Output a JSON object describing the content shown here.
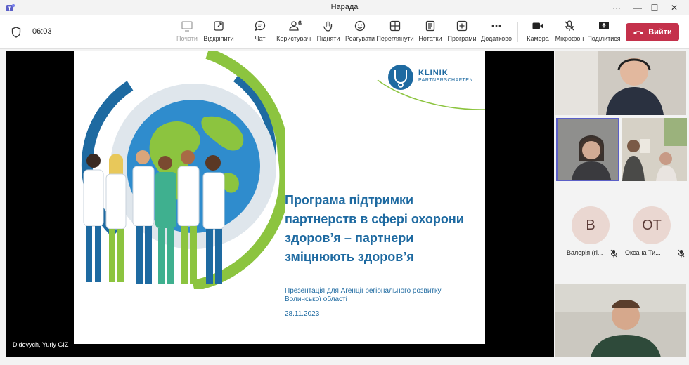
{
  "window": {
    "title": "Нарада"
  },
  "toolbar": {
    "timer": "06:03",
    "buttons": {
      "start": "Почати",
      "detach": "Відкріпити",
      "chat": "Чат",
      "people": "Користувачі",
      "people_count": "6",
      "raise": "Підняти",
      "react": "Реагувати",
      "view": "Переглянути",
      "notes": "Нотатки",
      "apps": "Програми",
      "more": "Додатково",
      "camera": "Камера",
      "mic": "Мікрофон",
      "share": "Поділитися"
    },
    "leave": "Вийти"
  },
  "stage": {
    "presenter": "Didevych, Yuriy GIZ",
    "slide": {
      "logo_line1": "KLINIK",
      "logo_line2": "PARTNERSCHAFTEN",
      "title_lines": [
        "Програма підтримки",
        "партнерств в сфері охорони",
        "здоров’я – партнери",
        "зміцнюють здоров’я"
      ],
      "subtitle_line1": "Презентація для Агенції регіонального розвитку",
      "subtitle_line2": "Волинської області",
      "date": "28.11.2023"
    }
  },
  "participants": [
    {
      "initials": "В",
      "name": "Валерія (гі..."
    },
    {
      "initials": "ОТ",
      "name": "Оксана Ти..."
    }
  ],
  "colors": {
    "accent": "#5b5fc7",
    "leave": "#c4314b",
    "slide_blue": "#1e6aa1",
    "slide_green": "#8cc43f"
  }
}
